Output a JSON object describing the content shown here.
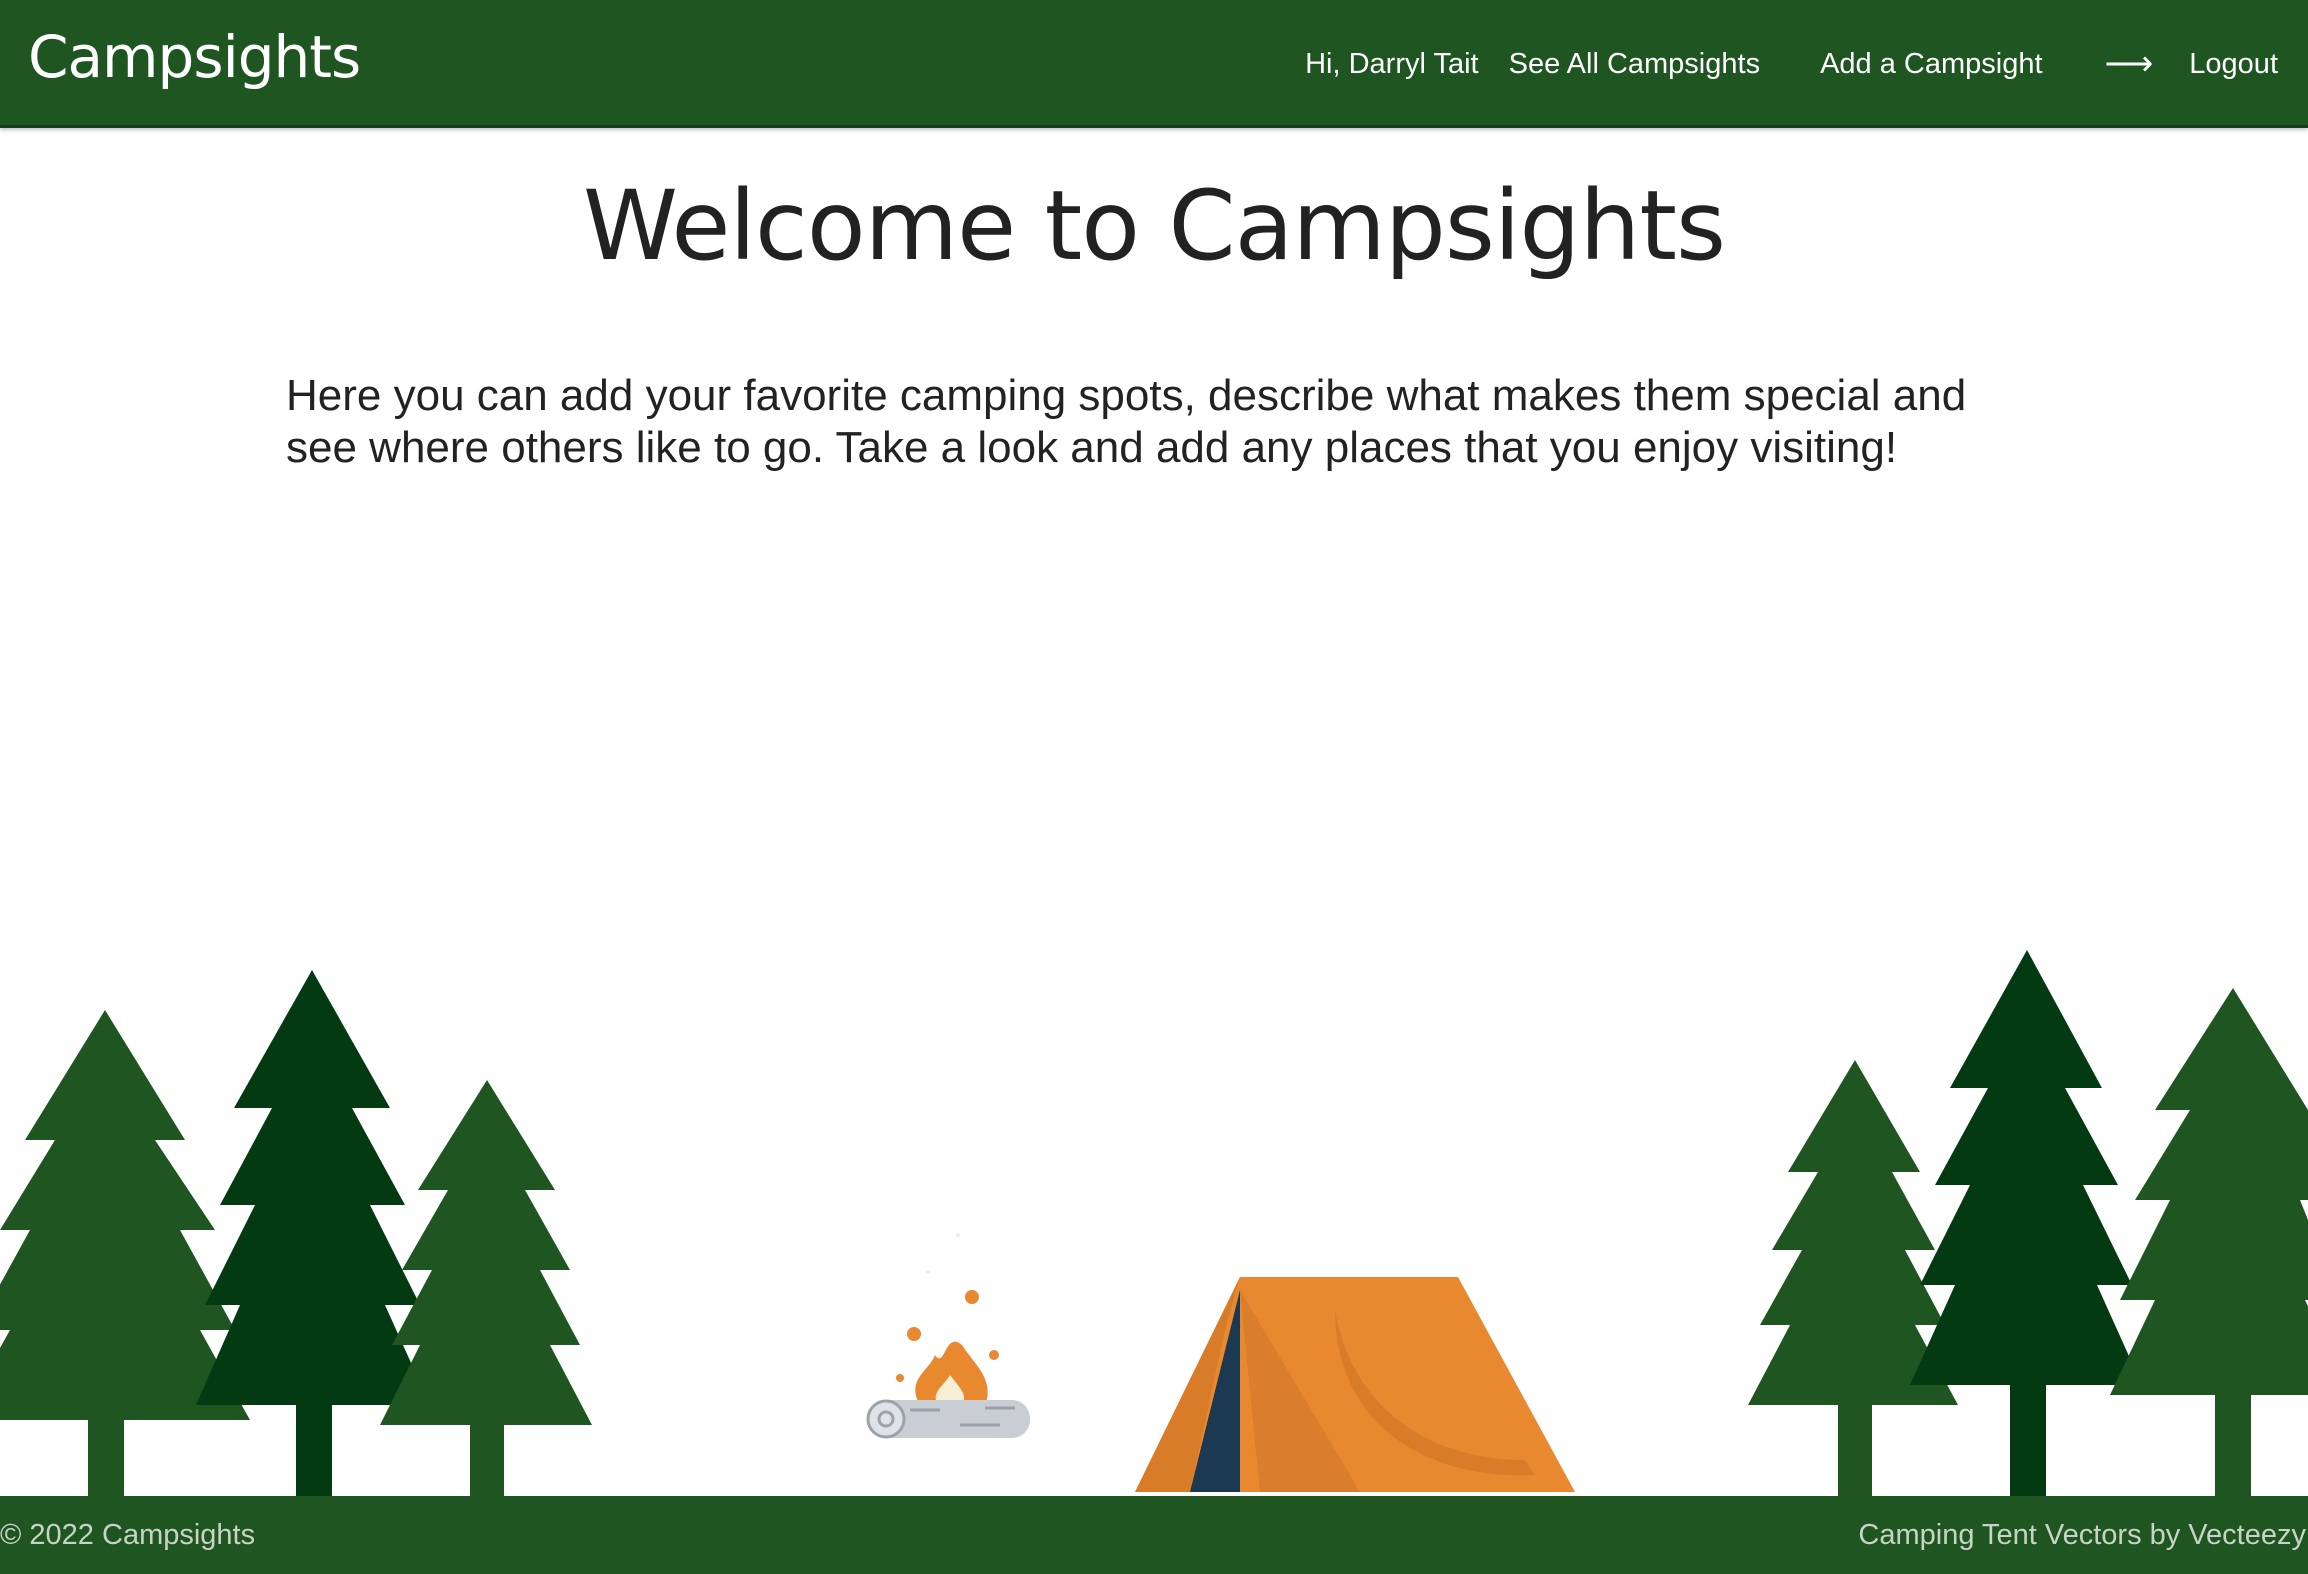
{
  "nav": {
    "brand": "Campsights",
    "greeting": "Hi, Darryl Tait",
    "see_all": "See All Campsights",
    "add": "Add a Campsight",
    "arrow": "⟶",
    "logout": "Logout"
  },
  "hero": {
    "title": "Welcome to Campsights",
    "text": "Here you can add your favorite camping spots, describe what makes them special and see where others like to go. Take a look and add any places that you enjoy visiting!"
  },
  "footer": {
    "copyright": "© 2022 Campsights",
    "credit": "Camping Tent Vectors by Vecteezy"
  },
  "colors": {
    "nav_bg": "#1e5520",
    "tree_light": "#1e5520",
    "tree_dark": "#033a12",
    "tent_orange": "#e88930",
    "tent_door": "#1b3a52",
    "fire": "#e88930",
    "log": "#c9ced4"
  },
  "icons": [
    "arrow-right-icon",
    "tree-icon",
    "tent-icon",
    "campfire-icon"
  ]
}
